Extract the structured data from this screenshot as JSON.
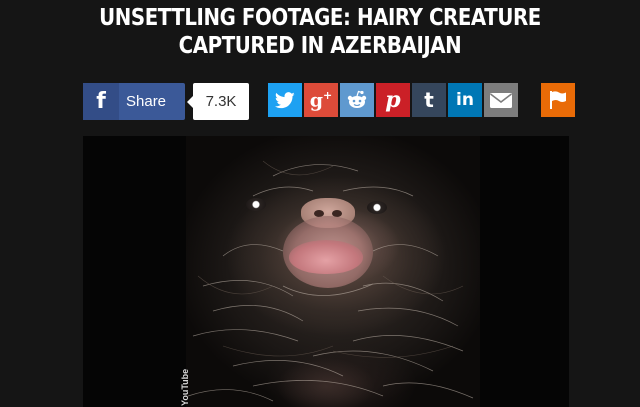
{
  "article": {
    "headline": "UNSETTLING FOOTAGE: HAIRY CREATURE CAPTURED IN AZERBAIJAN"
  },
  "share_bar": {
    "facebook_label": "Share",
    "facebook_count": "7.3K",
    "buttons": [
      {
        "name": "twitter-icon",
        "glyph": "🐦",
        "color": "#1da1f2"
      },
      {
        "name": "google-plus-icon",
        "glyph": "g+",
        "color": "#dd4b39"
      },
      {
        "name": "reddit-icon",
        "glyph": "reddit",
        "color": "#5f99cf"
      },
      {
        "name": "pinterest-icon",
        "glyph": "P",
        "color": "#cb2027"
      },
      {
        "name": "tumblr-icon",
        "glyph": "t",
        "color": "#35465c"
      },
      {
        "name": "linkedin-icon",
        "glyph": "in",
        "color": "#0077b5"
      },
      {
        "name": "email-icon",
        "glyph": "email",
        "color": "#7d7d7d"
      },
      {
        "name": "flag-icon",
        "glyph": "flag",
        "color": "#e96b07"
      }
    ]
  },
  "video": {
    "watermark": "YouTube"
  },
  "colors": {
    "background": "#151515",
    "facebook": "#3b5998"
  }
}
